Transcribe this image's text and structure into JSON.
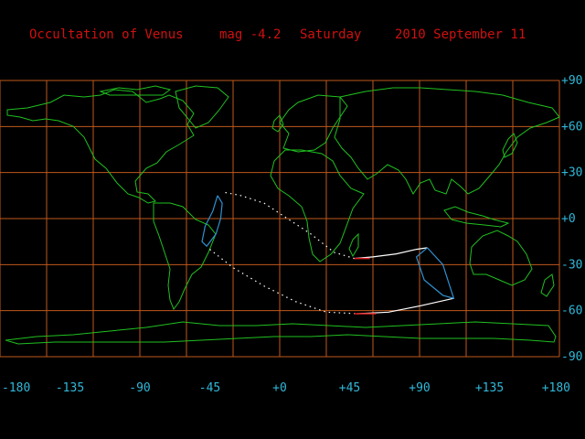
{
  "title": {
    "object": "Occultation of Venus",
    "magnitude": "mag -4.2",
    "weekday": "Saturday",
    "date": "2010 September 11"
  },
  "map": {
    "longitude_labels": [
      "-180",
      "-135",
      "-90",
      "-45",
      "+0",
      "+45",
      "+90",
      "+135",
      "+180"
    ],
    "latitude_labels": [
      "+90",
      "+60",
      "+30",
      "+0",
      "-30",
      "-60",
      "-90"
    ],
    "lon_range": [
      -180,
      180
    ],
    "lat_range": [
      -90,
      90
    ],
    "grid_step_deg": 30,
    "colors": {
      "grid": "#c0581c",
      "coast": "#20c020",
      "title": "#d01010",
      "labels": "#30b8d8",
      "limit_line": "#ffffff",
      "limit_red": "#e02020",
      "region_outline": "#3090d0"
    }
  },
  "occultation_path": {
    "northern_limit": [
      [
        -35,
        17
      ],
      [
        -25,
        15
      ],
      [
        -10,
        10
      ],
      [
        5,
        0
      ],
      [
        20,
        -10
      ],
      [
        35,
        -22
      ],
      [
        48,
        -26
      ],
      [
        60,
        -25
      ],
      [
        75,
        -23
      ],
      [
        88,
        -20
      ],
      [
        95,
        -19
      ]
    ],
    "southern_limit": [
      [
        -45,
        -20
      ],
      [
        -30,
        -32
      ],
      [
        -10,
        -44
      ],
      [
        10,
        -54
      ],
      [
        30,
        -61
      ],
      [
        50,
        -62
      ],
      [
        70,
        -61
      ],
      [
        90,
        -57
      ],
      [
        112,
        -52
      ]
    ],
    "red_segments": [
      [
        [
          48,
          -26
        ],
        [
          58,
          -26
        ]
      ],
      [
        [
          48,
          -62
        ],
        [
          62,
          -62
        ]
      ]
    ],
    "region_west": [
      [
        -40,
        15
      ],
      [
        -43,
        5
      ],
      [
        -48,
        -5
      ],
      [
        -50,
        -15
      ],
      [
        -47,
        -18
      ],
      [
        -41,
        -10
      ],
      [
        -38,
        0
      ],
      [
        -37,
        10
      ],
      [
        -40,
        15
      ]
    ],
    "region_east": [
      [
        95,
        -19
      ],
      [
        105,
        -30
      ],
      [
        112,
        -52
      ],
      [
        105,
        -50
      ],
      [
        93,
        -40
      ],
      [
        88,
        -25
      ],
      [
        95,
        -19
      ]
    ]
  }
}
